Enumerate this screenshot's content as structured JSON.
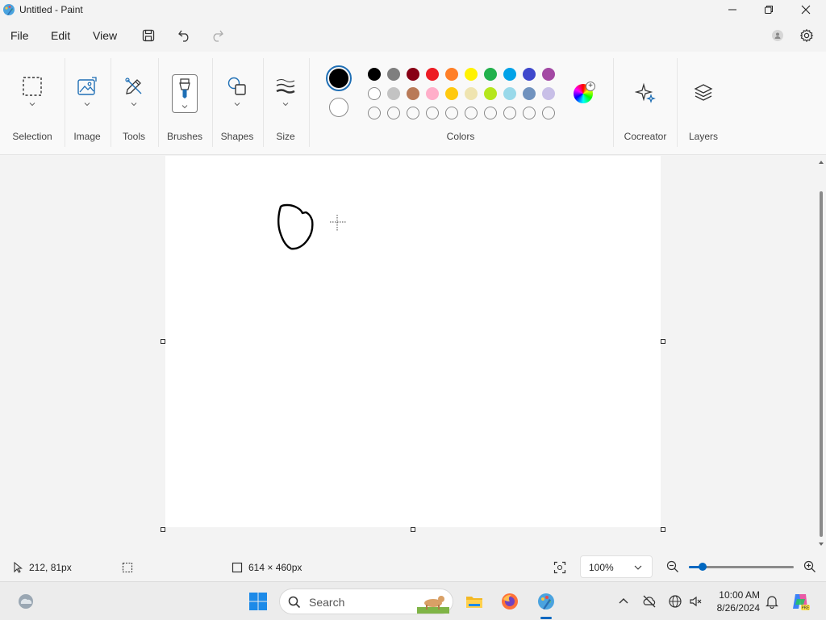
{
  "window": {
    "title": "Untitled - Paint"
  },
  "menu": {
    "file": "File",
    "edit": "Edit",
    "view": "View"
  },
  "ribbon": {
    "groups": {
      "selection": "Selection",
      "image": "Image",
      "tools": "Tools",
      "brushes": "Brushes",
      "shapes": "Shapes",
      "size": "Size",
      "colors": "Colors",
      "cocreator": "Cocreator",
      "layers": "Layers"
    },
    "primary_color": "#000000",
    "secondary_color": "#ffffff",
    "palette_row1": [
      "#000000",
      "#7f7f7f",
      "#880015",
      "#ed1c24",
      "#ff7f27",
      "#fff200",
      "#22b14c",
      "#00a2e8",
      "#3f48cc",
      "#a349a4"
    ],
    "palette_row2": [
      "#ffffff",
      "#c3c3c3",
      "#b97a57",
      "#ffaec9",
      "#ffc90e",
      "#efe4b0",
      "#b5e61d",
      "#99d9ea",
      "#7092be",
      "#c8bfe7"
    ],
    "palette_row3_count": 10
  },
  "status": {
    "cursor_position": "212, 81px",
    "canvas_size": "614 × 460px",
    "zoom": "100%",
    "zoom_fraction": 0.13
  },
  "taskbar": {
    "search_label": "Search",
    "time": "10:00 AM",
    "date": "8/26/2024"
  }
}
